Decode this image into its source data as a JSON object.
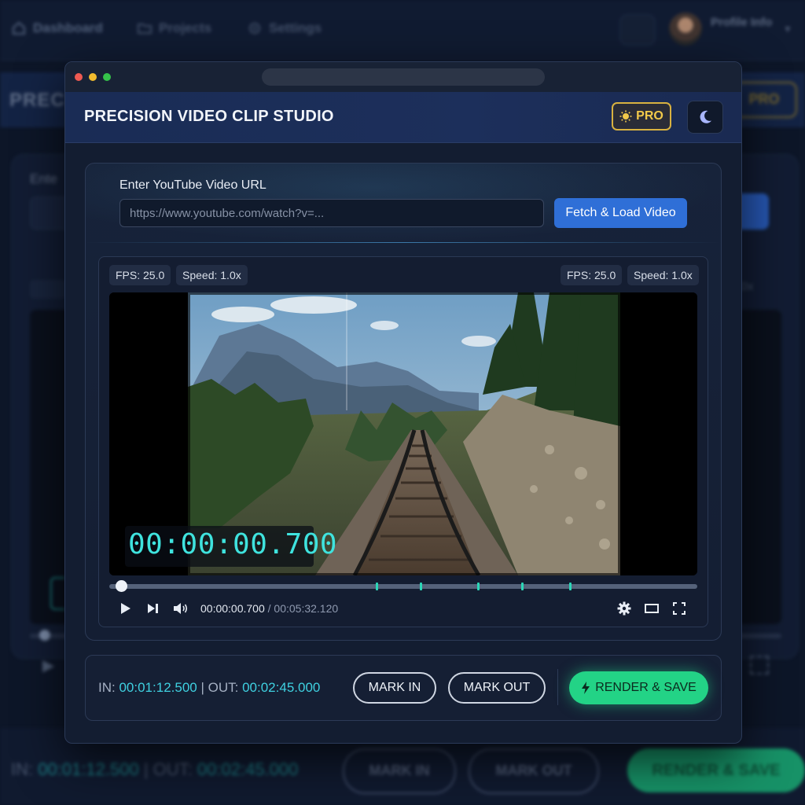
{
  "background": {
    "nav": [
      {
        "label": "Dashboard",
        "icon": "home-icon"
      },
      {
        "label": "Projects",
        "icon": "folder-icon"
      },
      {
        "label": "Settings",
        "icon": "gear-icon"
      }
    ],
    "profile_name": "Profile Info",
    "header_title": "PREC",
    "pro_label": "PRO",
    "enter_label": "Ente",
    "in_label": "IN:",
    "in_value": "00:01:12.500",
    "out_label": "OUT:",
    "out_value": "00:02:45.000",
    "mark_in": "MARK IN",
    "mark_out": "MARK OUT",
    "render": "RENDER & SAVE"
  },
  "app": {
    "title": "PRECISION VIDEO CLIP STUDIO",
    "pro_badge": "PRO",
    "theme_icon": "moon-icon",
    "accent_color": "#2f6fd7",
    "success_color": "#23d386"
  },
  "url": {
    "label": "Enter YouTube Video URL",
    "placeholder": "https://www.youtube.com/watch?v=...",
    "value": "",
    "fetch_button": "Fetch & Load Video"
  },
  "player": {
    "fps_left": "FPS: 25.0",
    "speed_left": "Speed: 1.0x",
    "fps_right": "FPS: 25.0",
    "speed_right": "Speed: 1.0x",
    "timecode": "00:00:00.700",
    "current_time": "00:00:00.700",
    "duration": "/ 00:05:32.120",
    "progress": 0.0021,
    "controls": [
      "play-icon",
      "next-frame-icon",
      "volume-icon",
      "settings-icon",
      "theater-mode-icon",
      "fullscreen-icon"
    ]
  },
  "clip": {
    "in_label": "IN:",
    "in_value": "00:01:12.500",
    "separator": "|",
    "out_label": "OUT:",
    "out_value": "00:02:45.000",
    "mark_in_button": "MARK IN",
    "mark_out_button": "MARK OUT",
    "render_button": "RENDER & SAVE"
  }
}
